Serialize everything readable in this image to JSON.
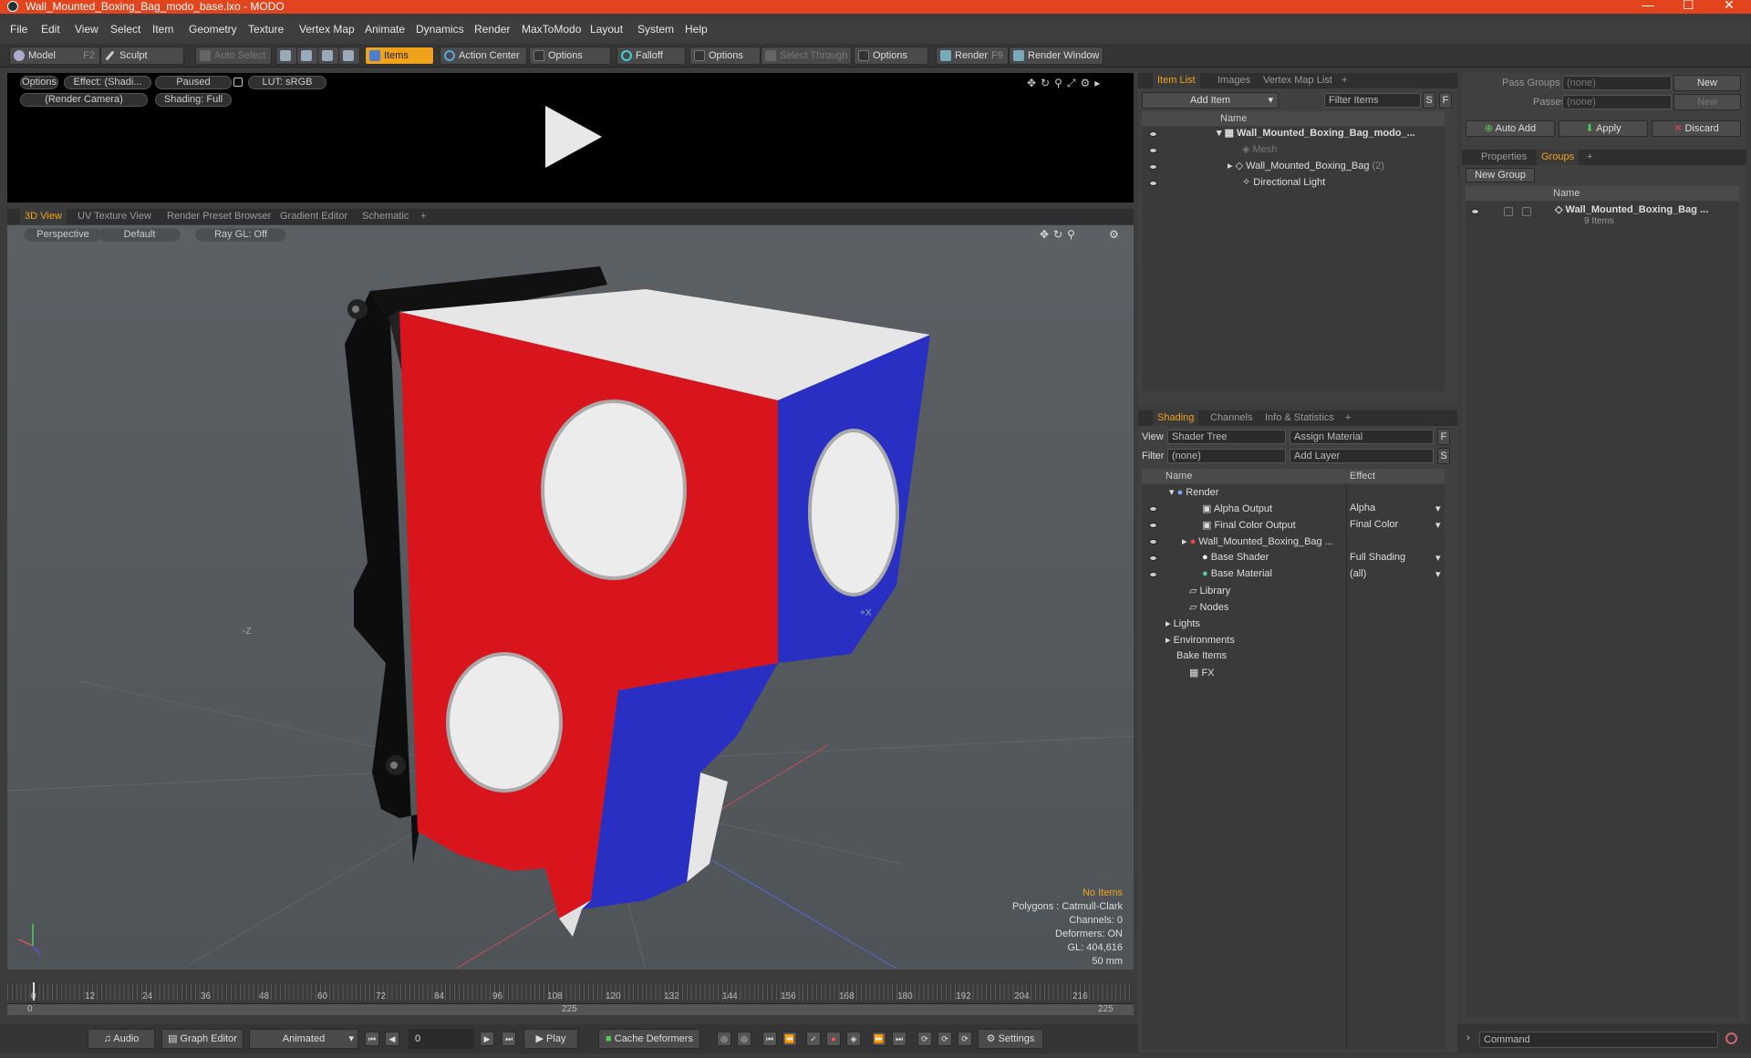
{
  "window": {
    "title": "Wall_Mounted_Boxing_Bag_modo_base.lxo - MODO",
    "minimize": "—",
    "maximize": "☐",
    "close": "✕"
  },
  "menu": [
    "File",
    "Edit",
    "View",
    "Select",
    "Item",
    "Geometry",
    "Texture",
    "Vertex Map",
    "Animate",
    "Dynamics",
    "Render",
    "MaxToModo",
    "Layout",
    "System",
    "Help"
  ],
  "toolbar": {
    "model": "Model",
    "model_key": "F2",
    "sculpt": "Sculpt",
    "auto_select": "Auto Select",
    "items": "Items",
    "action_center": "Action Center",
    "options1": "Options",
    "falloff": "Falloff",
    "options2": "Options",
    "select_through": "Select Through",
    "options3": "Options",
    "render": "Render",
    "render_key": "F9",
    "render_window": "Render Window"
  },
  "preview": {
    "options": "Options",
    "effect": "Effect: (Shadi...",
    "paused": "Paused",
    "lut": "LUT: sRGB",
    "camera": "(Render Camera)",
    "shading": "Shading: Full"
  },
  "viewtabs": [
    "3D View",
    "UV Texture View",
    "Render Preset Browser",
    "Gradient Editor",
    "Schematic",
    "+"
  ],
  "viewport": {
    "perspective": "Perspective",
    "default": "Default",
    "raygl": "Ray GL: Off",
    "axis_neg_z": "-Z",
    "axis_pos_x": "+X",
    "stats": {
      "no_items": "No Items",
      "polygons": "Polygons : Catmull-Clark",
      "channels": "Channels: 0",
      "deformers": "Deformers: ON",
      "gl": "GL: 404,616",
      "size": "50 mm"
    }
  },
  "timeline": {
    "ticks": [
      "0",
      "12",
      "24",
      "36",
      "48",
      "60",
      "72",
      "84",
      "96",
      "108",
      "120",
      "132",
      "144",
      "156",
      "168",
      "180",
      "192",
      "204",
      "216"
    ],
    "range_start": "0",
    "range_mid": "225",
    "range_end": "225"
  },
  "bottombar": {
    "audio": "Audio",
    "graph_editor": "Graph Editor",
    "animated": "Animated",
    "frame": "0",
    "play": "Play",
    "cache_deformers": "Cache Deformers",
    "settings": "Settings",
    "command": "Command"
  },
  "itemlist": {
    "tabs": [
      "Item List",
      "Images",
      "Vertex Map List",
      "+"
    ],
    "add_item": "Add Item",
    "filter_items": "Filter Items",
    "s": "S",
    "f": "F",
    "name_header": "Name",
    "rows": [
      {
        "label": "Wall_Mounted_Boxing_Bag_modo_...",
        "count": ""
      },
      {
        "label": "Mesh",
        "count": ""
      },
      {
        "label": "Wall_Mounted_Boxing_Bag",
        "count": "(2)"
      },
      {
        "label": "Directional Light",
        "count": ""
      }
    ]
  },
  "shading": {
    "tabs": [
      "Shading",
      "Channels",
      "Info & Statistics",
      "+"
    ],
    "view_label": "View",
    "view_value": "Shader Tree",
    "assign_material": "Assign Material",
    "f": "F",
    "filter_label": "Filter",
    "filter_value": "(none)",
    "add_layer": "Add Layer",
    "s": "S",
    "name_header": "Name",
    "effect_header": "Effect",
    "rows": [
      {
        "name": "Render",
        "effect": ""
      },
      {
        "name": "Alpha Output",
        "effect": "Alpha"
      },
      {
        "name": "Final Color Output",
        "effect": "Final Color"
      },
      {
        "name": "Wall_Mounted_Boxing_Bag ...",
        "effect": ""
      },
      {
        "name": "Base Shader",
        "effect": "Full Shading"
      },
      {
        "name": "Base Material",
        "effect": "(all)"
      },
      {
        "name": "Library",
        "effect": ""
      },
      {
        "name": "Nodes",
        "effect": ""
      },
      {
        "name": "Lights",
        "effect": ""
      },
      {
        "name": "Environments",
        "effect": ""
      },
      {
        "name": "Bake Items",
        "effect": ""
      },
      {
        "name": "FX",
        "effect": ""
      }
    ]
  },
  "groups": {
    "pass_groups": "Pass Groups",
    "pass_groups_value": "(none)",
    "new1": "New",
    "passes": "Passes",
    "passes_value": "(none)",
    "new2": "New",
    "auto_add": "Auto Add",
    "apply": "Apply",
    "discard": "Discard",
    "tabs": [
      "Properties",
      "Groups",
      "+"
    ],
    "new_group": "New Group",
    "name_header": "Name",
    "group_name": "Wall_Mounted_Boxing_Bag ...",
    "group_count": "9 Items"
  },
  "colors": {
    "accent": "#f0a21a",
    "titlebar": "#e2451d",
    "bag_red": "#d8141c",
    "bag_blue": "#2a2fc4"
  }
}
